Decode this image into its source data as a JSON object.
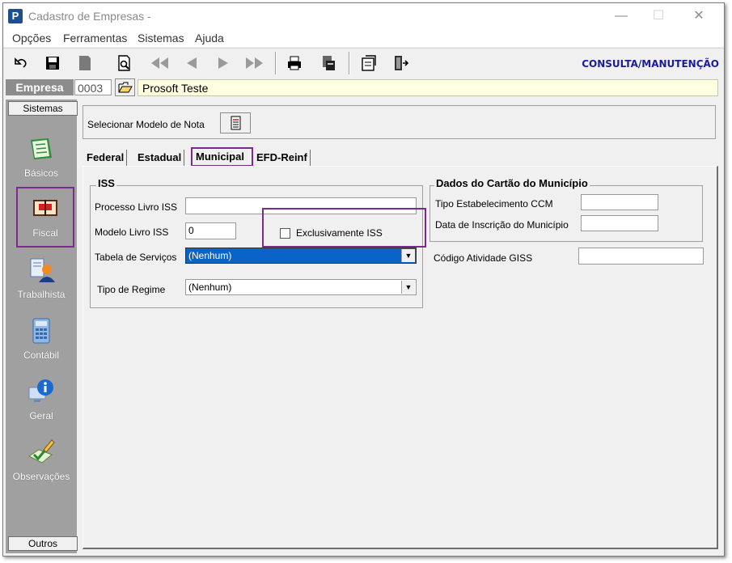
{
  "window": {
    "title": "Cadastro de Empresas -",
    "app_icon": "P",
    "controls": {
      "minimize": "—",
      "maximize": "☐",
      "close": "✕"
    }
  },
  "menu": [
    "Opções",
    "Ferramentas",
    "Sistemas",
    "Ajuda"
  ],
  "toolbar": {
    "mode_label": "CONSULTA/MANUTENÇÃO",
    "icons": [
      "undo-icon",
      "save-icon",
      "bookmark-icon",
      "print-preview-icon",
      "first-record-icon",
      "previous-record-icon",
      "next-record-icon",
      "last-record-icon",
      "printer-icon",
      "report-icon",
      "notes-icon",
      "exit-door-icon"
    ]
  },
  "empresa": {
    "label": "Empresa",
    "code": "0003",
    "name": "Prosoft Teste"
  },
  "sidebar": {
    "header": "Sistemas",
    "items": [
      {
        "label": "Básicos",
        "icon": "book-icon"
      },
      {
        "label": "Fiscal",
        "icon": "ledger-icon"
      },
      {
        "label": "Trabalhista",
        "icon": "worker-icon"
      },
      {
        "label": "Contábil",
        "icon": "calculator-icon"
      },
      {
        "label": "Geral",
        "icon": "info-monitor-icon"
      },
      {
        "label": "Observações",
        "icon": "pencil-check-icon"
      }
    ],
    "footer": "Outros"
  },
  "modelo": {
    "label": "Selecionar Modelo de Nota"
  },
  "tabs": [
    "Federal",
    "Estadual",
    "Municipal",
    "EFD-Reinf"
  ],
  "active_tab": "Municipal",
  "iss": {
    "title": "ISS",
    "processo_label": "Processo Livro ISS",
    "processo_value": "",
    "modelo_label": "Modelo Livro ISS",
    "modelo_value": "0",
    "exclusivo_label": "Exclusivamente ISS",
    "tabela_label": "Tabela de Serviços",
    "tabela_value": "(Nenhum)",
    "regime_label": "Tipo de Regime",
    "regime_value": "(Nenhum)"
  },
  "cartao": {
    "title": "Dados do Cartão do Município",
    "ccm_label": "Tipo Estabelecimento CCM",
    "ccm_value": "",
    "inscricao_label": "Data de Inscrição do Município",
    "inscricao_value": ""
  },
  "giss": {
    "label": "Código Atividade GISS",
    "value": ""
  },
  "colors": {
    "accent_highlight": "#7d2a8e",
    "mode_label": "#1a1a9c",
    "selection": "#0a64c8",
    "sidebar": "#a0a0a0",
    "empresa_bg": "#ffffe1"
  }
}
